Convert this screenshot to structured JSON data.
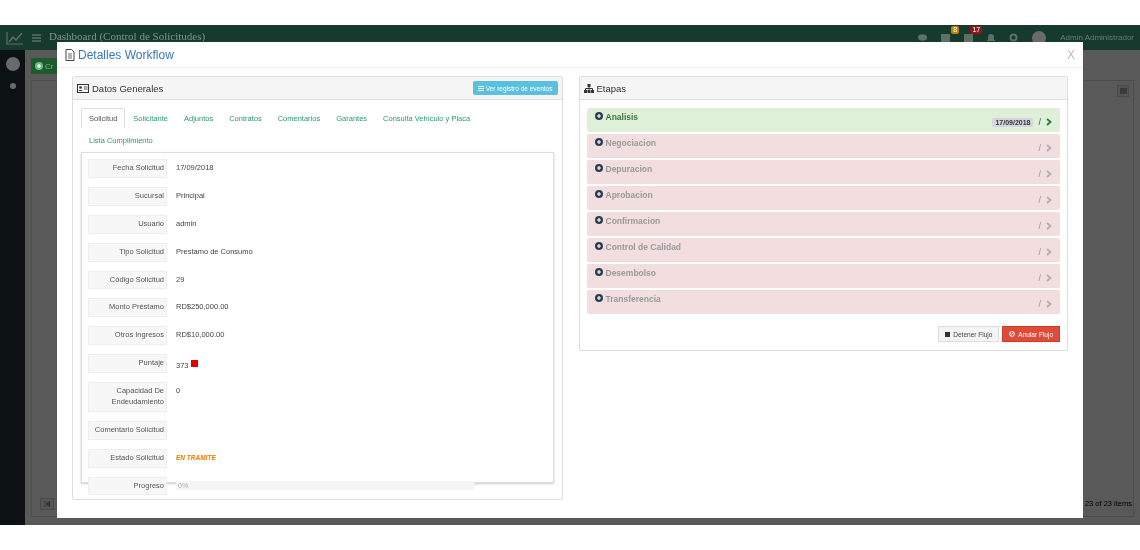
{
  "app_header": {
    "title": "Dashboard (Control de Solicitudes)",
    "user": "Admin Administrador",
    "badges": [
      {
        "count": "8",
        "color": "#b8860b"
      },
      {
        "count": "17",
        "color": "#8b1a1a"
      }
    ]
  },
  "background": {
    "create_button": "Cr",
    "pager_info": "23 of 23 items"
  },
  "modal": {
    "title": "Detalles Workflow",
    "close": "X"
  },
  "general": {
    "title": "Datos Generales",
    "events_button": "Ver registro de eventos",
    "tabs": [
      {
        "label": "Solicitud",
        "selected": true
      },
      {
        "label": "Solicitante",
        "selected": false
      },
      {
        "label": "Adjuntos",
        "selected": false
      },
      {
        "label": "Contratos",
        "selected": false
      },
      {
        "label": "Comentarios",
        "selected": false
      },
      {
        "label": "Garantes",
        "selected": false
      },
      {
        "label": "Consulta Vehículo y Placa",
        "selected": false
      },
      {
        "label": "Lista Cumplimiento",
        "selected": false
      }
    ],
    "fields": [
      {
        "kind": "text",
        "label": "Fecha Solicitud",
        "value": "17/09/2018"
      },
      {
        "kind": "text",
        "label": "Sucursal",
        "value": "Principal"
      },
      {
        "kind": "text",
        "label": "Usuario",
        "value": "admin"
      },
      {
        "kind": "text",
        "label": "Tipo Solicitud",
        "value": "Prestamo de Consumo"
      },
      {
        "kind": "text",
        "label": "Código Solicitud",
        "value": "29"
      },
      {
        "kind": "text",
        "label": "Monto Préstamo",
        "value": "RD$250,000.00"
      },
      {
        "kind": "text",
        "label": "Otros Ingresos",
        "value": "RD$10,000.00"
      },
      {
        "kind": "score",
        "label": "Puntaje",
        "value": "373",
        "color": "#e00000"
      },
      {
        "kind": "text",
        "label": "Capacidad De Endeudamiento",
        "value": "0"
      },
      {
        "kind": "text",
        "label": "Comentario Solicitud"
      },
      {
        "kind": "status",
        "label": "Estado Solicitud",
        "value": "EN TRAMITE"
      },
      {
        "kind": "progress",
        "label": "Progreso",
        "level": 0,
        "reading": "0%"
      }
    ]
  },
  "stages": {
    "title": "Etapas",
    "items": [
      {
        "name": "Analisis",
        "completed": true,
        "date": "17/09/2018",
        "separator": "/"
      },
      {
        "name": "Negociacion",
        "completed": false,
        "separator": "/"
      },
      {
        "name": "Depuracion",
        "completed": false,
        "separator": "/"
      },
      {
        "name": "Aprobacion",
        "completed": false,
        "separator": "/"
      },
      {
        "name": "Confirmacion",
        "completed": false,
        "separator": "/"
      },
      {
        "name": "Control de Calidad",
        "completed": false,
        "separator": "/"
      },
      {
        "name": "Desembolso",
        "completed": false,
        "separator": "/"
      },
      {
        "name": "Transferencia",
        "completed": false,
        "separator": "/"
      }
    ],
    "stop_button": "Detener Flujo",
    "cancel_button": "Anular Flujo"
  }
}
